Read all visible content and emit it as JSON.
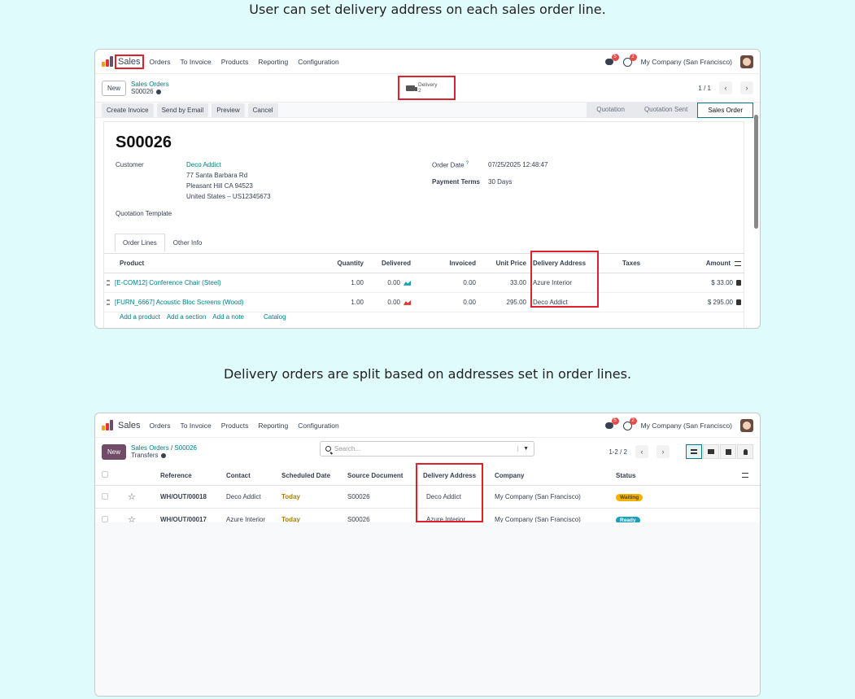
{
  "captions": {
    "top": "User can set delivery address on each sales order line.",
    "bottom": "Delivery orders are split based on addresses set in order lines."
  },
  "colors": {
    "brand": "#714b67",
    "accent": "#017e84",
    "highlight": "#e0202a",
    "waiting": "#f3b200",
    "ready": "#17a2b8"
  },
  "navbar": {
    "app": "Sales",
    "menu": [
      "Orders",
      "To Invoice",
      "Products",
      "Reporting",
      "Configuration"
    ],
    "messages_badge": "5",
    "activities_badge": "2",
    "company": "My Company (San Francisco)"
  },
  "form": {
    "new_label": "New",
    "breadcrumb_parent": "Sales Orders",
    "breadcrumb_current": "S00026",
    "smart_button": {
      "label": "Delivery",
      "count": "2"
    },
    "pager": "1 / 1",
    "actions": [
      "Create Invoice",
      "Send by Email",
      "Preview",
      "Cancel"
    ],
    "stages": [
      "Quotation",
      "Quotation Sent",
      "Sales Order"
    ],
    "title": "S00026",
    "customer_label": "Customer",
    "customer": {
      "name": "Deco Addict",
      "line1": "77 Santa Barbara Rd",
      "line2": "Pleasant Hill CA 94523",
      "line3": "United States – US12345673"
    },
    "order_date_label": "Order Date",
    "order_date_help": "?",
    "order_date": "07/25/2025 12:48:47",
    "payment_terms_label": "Payment Terms",
    "payment_terms": "30 Days",
    "quotation_template_label": "Quotation Template",
    "tabs": [
      "Order Lines",
      "Other Info"
    ],
    "columns": [
      "Product",
      "Quantity",
      "Delivered",
      "Invoiced",
      "Unit Price",
      "Delivery Address",
      "Taxes",
      "Amount"
    ],
    "lines": [
      {
        "product": "[E-COM12] Conference Chair (Steel)",
        "quantity": "1.00",
        "delivered": "0.00",
        "invoiced": "0.00",
        "unit_price": "33.00",
        "delivery_address": "Azure Interior",
        "taxes": "",
        "amount": "$ 33.00"
      },
      {
        "product": "[FURN_6667] Acoustic Bloc Screens (Wood)",
        "quantity": "1.00",
        "delivered": "0.00",
        "invoiced": "0.00",
        "unit_price": "295.00",
        "delivery_address": "Deco Addict",
        "taxes": "",
        "amount": "$ 295.00"
      }
    ],
    "add_links": [
      "Add a product",
      "Add a section",
      "Add a note",
      "Catalog"
    ]
  },
  "list": {
    "new_label": "New",
    "breadcrumb_parent": "Sales Orders",
    "breadcrumb_sep": "/",
    "breadcrumb_mid": "S00026",
    "breadcrumb_current": "Transfers",
    "search_placeholder": "Search...",
    "pager": "1-2 / 2",
    "columns": [
      "Reference",
      "Contact",
      "Scheduled Date",
      "Source Document",
      "Delivery Address",
      "Company",
      "Status"
    ],
    "rows": [
      {
        "reference": "WH/OUT/00018",
        "contact": "Deco Addict",
        "scheduled": "Today",
        "source": "S00026",
        "delivery_address": "Deco Addict",
        "company": "My Company (San Francisco)",
        "status": "Waiting"
      },
      {
        "reference": "WH/OUT/00017",
        "contact": "Azure Interior",
        "scheduled": "Today",
        "source": "S00026",
        "delivery_address": "Azure Interior",
        "company": "My Company (San Francisco)",
        "status": "Ready"
      }
    ]
  }
}
